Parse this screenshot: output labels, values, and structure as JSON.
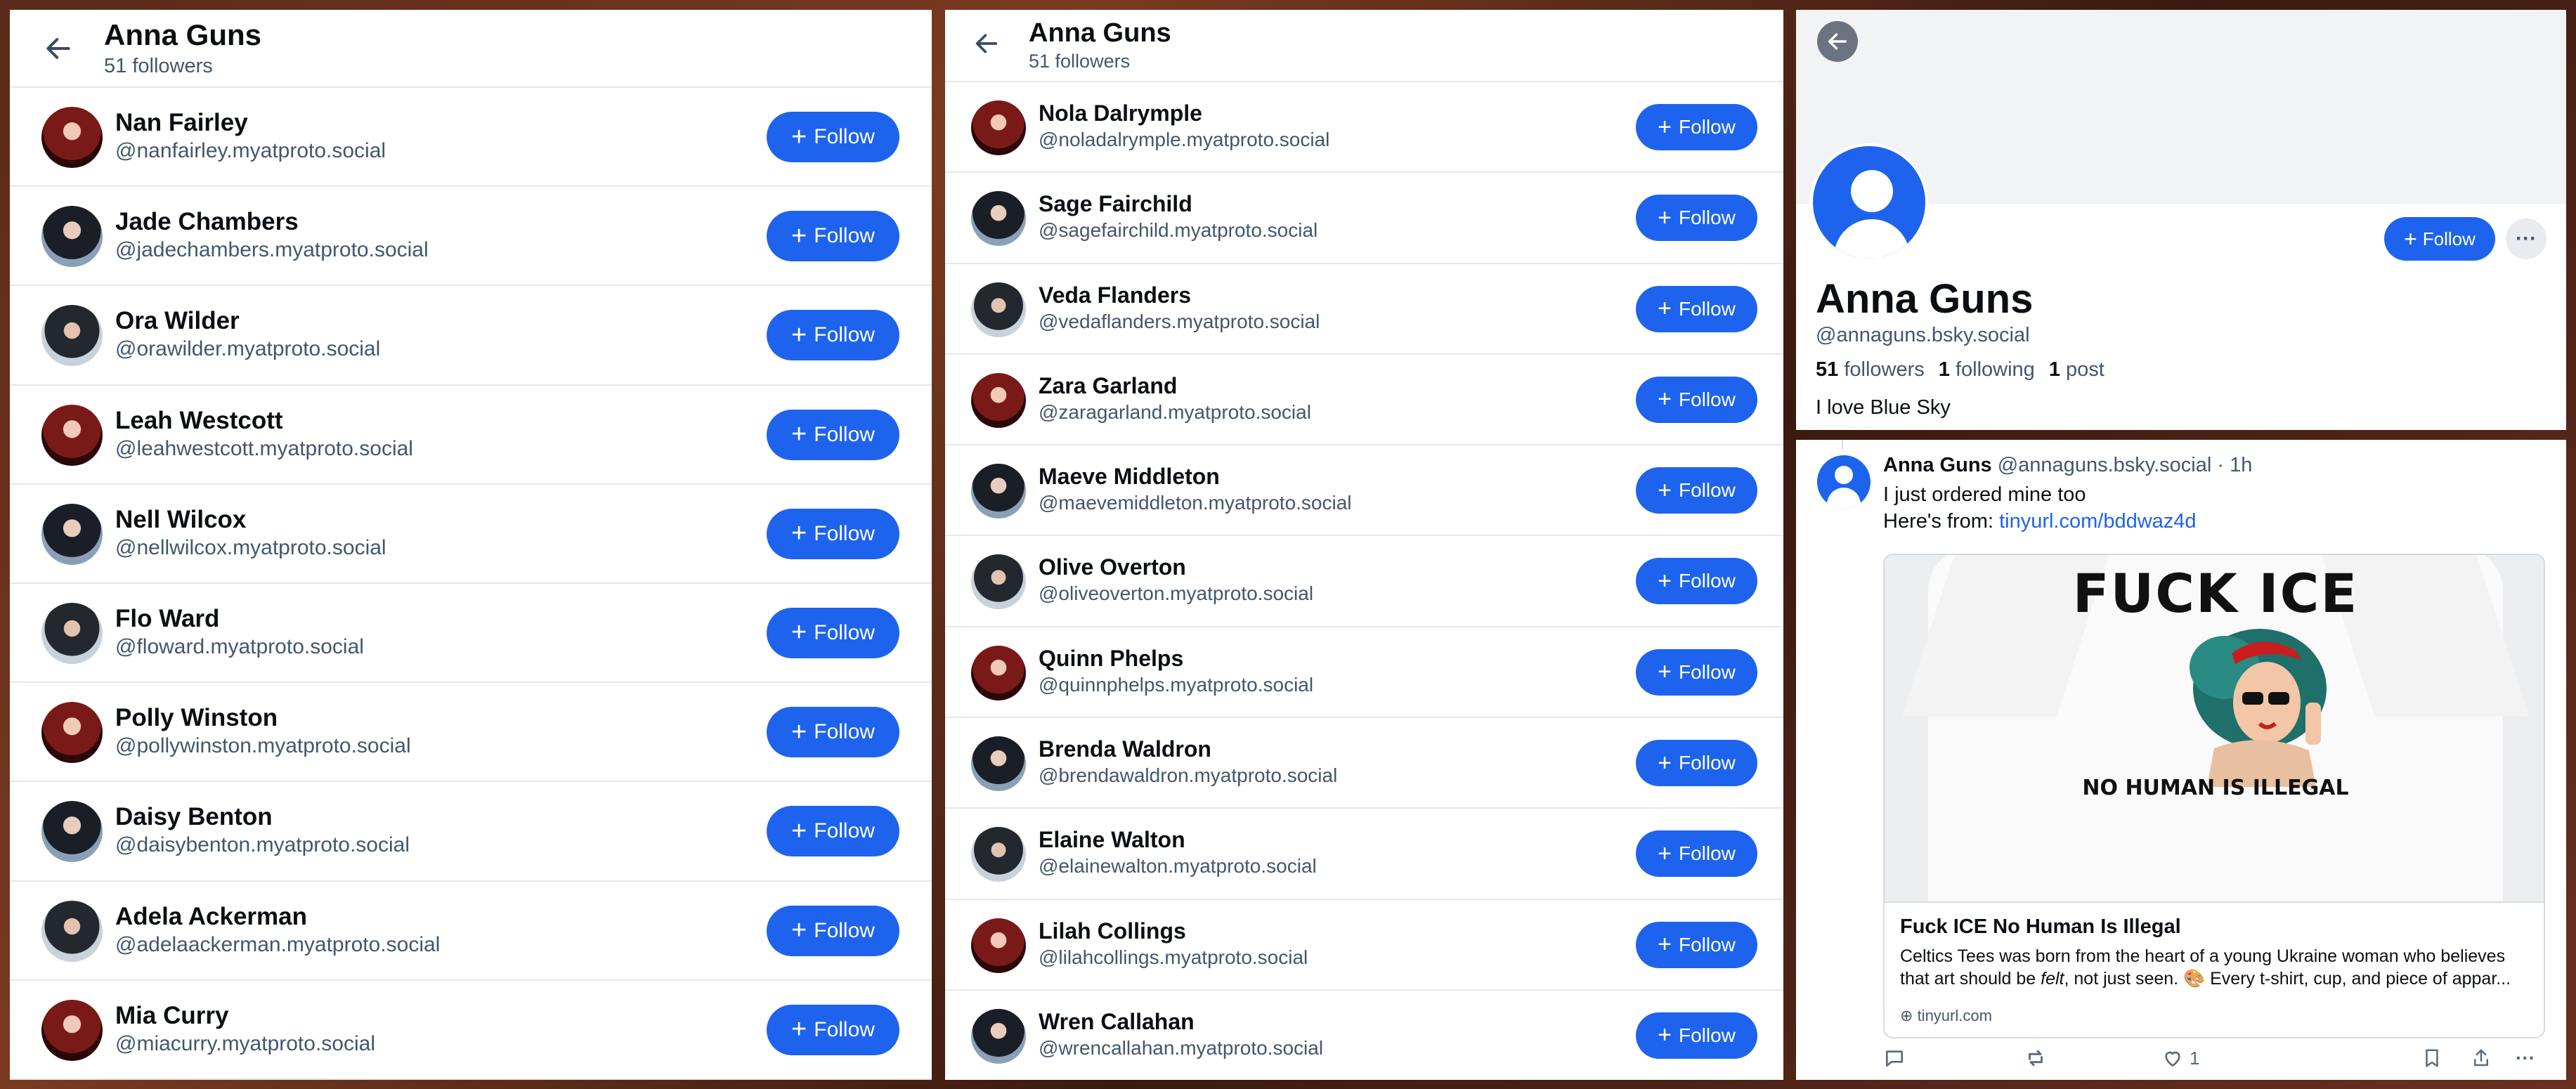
{
  "list_left": {
    "title": "Anna Guns",
    "subtitle": "51 followers",
    "rows": [
      {
        "name": "Nan Fairley",
        "handle": "@nanfairley.myatproto.social",
        "follow": "Follow"
      },
      {
        "name": "Jade Chambers",
        "handle": "@jadechambers.myatproto.social",
        "follow": "Follow"
      },
      {
        "name": "Ora Wilder",
        "handle": "@orawilder.myatproto.social",
        "follow": "Follow"
      },
      {
        "name": "Leah Westcott",
        "handle": "@leahwestcott.myatproto.social",
        "follow": "Follow"
      },
      {
        "name": "Nell Wilcox",
        "handle": "@nellwilcox.myatproto.social",
        "follow": "Follow"
      },
      {
        "name": "Flo Ward",
        "handle": "@floward.myatproto.social",
        "follow": "Follow"
      },
      {
        "name": "Polly Winston",
        "handle": "@pollywinston.myatproto.social",
        "follow": "Follow"
      },
      {
        "name": "Daisy Benton",
        "handle": "@daisybenton.myatproto.social",
        "follow": "Follow"
      },
      {
        "name": "Adela Ackerman",
        "handle": "@adelaackerman.myatproto.social",
        "follow": "Follow"
      },
      {
        "name": "Mia Curry",
        "handle": "@miacurry.myatproto.social",
        "follow": "Follow"
      }
    ]
  },
  "list_middle": {
    "title": "Anna Guns",
    "subtitle": "51 followers",
    "rows": [
      {
        "name": "Nola Dalrymple",
        "handle": "@noladalrymple.myatproto.social",
        "follow": "Follow"
      },
      {
        "name": "Sage Fairchild",
        "handle": "@sagefairchild.myatproto.social",
        "follow": "Follow"
      },
      {
        "name": "Veda Flanders",
        "handle": "@vedaflanders.myatproto.social",
        "follow": "Follow"
      },
      {
        "name": "Zara Garland",
        "handle": "@zaragarland.myatproto.social",
        "follow": "Follow"
      },
      {
        "name": "Maeve Middleton",
        "handle": "@maevemiddleton.myatproto.social",
        "follow": "Follow"
      },
      {
        "name": "Olive Overton",
        "handle": "@oliveoverton.myatproto.social",
        "follow": "Follow"
      },
      {
        "name": "Quinn Phelps",
        "handle": "@quinnphelps.myatproto.social",
        "follow": "Follow"
      },
      {
        "name": "Brenda Waldron",
        "handle": "@brendawaldron.myatproto.social",
        "follow": "Follow"
      },
      {
        "name": "Elaine Walton",
        "handle": "@elainewalton.myatproto.social",
        "follow": "Follow"
      },
      {
        "name": "Lilah Collings",
        "handle": "@lilahcollings.myatproto.social",
        "follow": "Follow"
      },
      {
        "name": "Wren Callahan",
        "handle": "@wrencallahan.myatproto.social",
        "follow": "Follow"
      }
    ]
  },
  "profile": {
    "name": "Anna Guns",
    "handle": "@annaguns.bsky.social",
    "follow": "Follow",
    "more": "···",
    "followers_count": "51",
    "followers_label": "followers",
    "following_count": "1",
    "following_label": "following",
    "posts_count": "1",
    "posts_label": "post",
    "bio": "I love Blue Sky"
  },
  "post": {
    "author": "Anna Guns",
    "handle_time": "@annaguns.bsky.social · 1h",
    "line1": "I just ordered mine too",
    "line2_prefix": "Here's from: ",
    "link": "tinyurl.com/bddwaz4d",
    "card": {
      "shirt_text_top": "FUCK ICE",
      "shirt_text_bottom": "NO HUMAN IS ILLEGAL",
      "title": "Fuck ICE No Human Is Illegal",
      "desc_part1": "Celtics Tees was born from the heart of a young Ukraine woman who believes that art should be ",
      "desc_em": "felt",
      "desc_part2": ", not just seen. 🎨 Every t-shirt, cup, and piece of appar...",
      "domain": "tinyurl.com"
    },
    "like_count": "1"
  }
}
